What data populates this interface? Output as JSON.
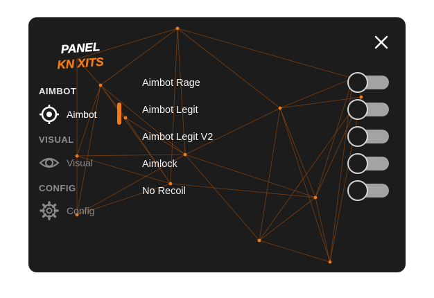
{
  "window": {
    "logo_text_line1": "PANEL",
    "logo_text_line2": "KN XITS",
    "close_icon": "close-icon"
  },
  "sidebar": {
    "sections": [
      {
        "title": "AIMBOT",
        "item_label": "Aimbot",
        "icon": "crosshair-icon",
        "active": true
      },
      {
        "title": "VISUAL",
        "item_label": "Visual",
        "icon": "eye-icon",
        "active": false
      },
      {
        "title": "CONFIG",
        "item_label": "Config",
        "icon": "gear-icon",
        "active": false
      }
    ]
  },
  "main": {
    "options": [
      {
        "label": "Aimbot Rage",
        "enabled": false
      },
      {
        "label": "Aimbot Legit",
        "enabled": false
      },
      {
        "label": "Aimbot Legit V2",
        "enabled": false
      },
      {
        "label": "Aimlock",
        "enabled": false
      },
      {
        "label": "No Recoil",
        "enabled": false
      }
    ]
  },
  "colors": {
    "accent": "#f07a16",
    "panel_background": "#1c1c1c",
    "toggle_track": "#a3a3a3",
    "toggle_knob_border": "#d6d6d6",
    "web_line": "#9b4a0d"
  }
}
